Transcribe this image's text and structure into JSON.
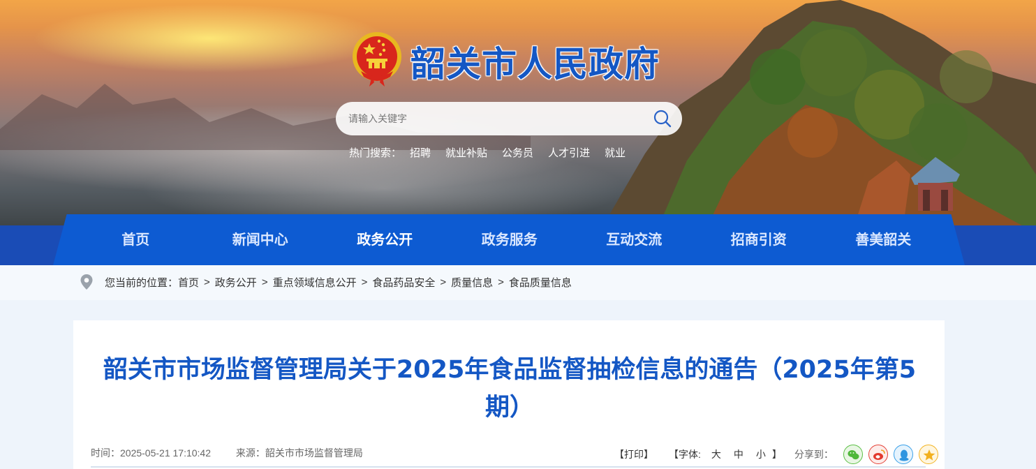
{
  "header": {
    "site_title": "韶关市人民政府",
    "emblem": "national-emblem"
  },
  "search": {
    "placeholder": "请输入关键字",
    "hot_label": "热门搜索：",
    "hot_items": [
      "招聘",
      "就业补贴",
      "公务员",
      "人才引进",
      "就业"
    ]
  },
  "nav": {
    "items": [
      "首页",
      "新闻中心",
      "政务公开",
      "政务服务",
      "互动交流",
      "招商引资",
      "善美韶关"
    ],
    "active_index": 2
  },
  "breadcrumb": {
    "prefix": "您当前的位置：",
    "items": [
      "首页",
      "政务公开",
      "重点领域信息公开",
      "食品药品安全",
      "质量信息",
      "食品质量信息"
    ],
    "separator": ">"
  },
  "article": {
    "title": "韶关市市场监督管理局关于2025年食品监督抽检信息的通告（2025年第5期）",
    "time_label": "时间：",
    "time": "2025-05-21 17:10:42",
    "source_label": "来源：",
    "source": "韶关市市场监督管理局"
  },
  "tools": {
    "print": "【打印】",
    "font_label": "【字体:",
    "font_sizes": [
      "大",
      "中",
      "小"
    ],
    "font_close": "】",
    "share_label": "分享到：",
    "share_icons": [
      "wechat-icon",
      "weibo-icon",
      "qq-icon",
      "qzone-icon"
    ]
  },
  "colors": {
    "brand_blue": "#1457c4",
    "nav_blue": "#0d5bd2",
    "nav_band": "#1a4cb6"
  }
}
